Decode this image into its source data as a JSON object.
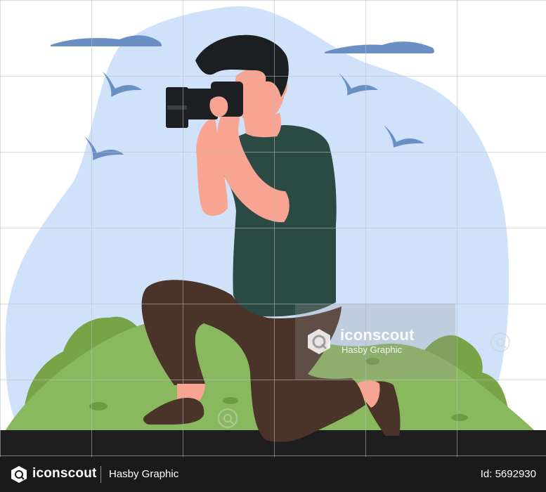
{
  "watermark": {
    "brand": "iconscout",
    "author": "Hasby Graphic"
  },
  "footer": {
    "brand": "iconscout",
    "author": "Hasby Graphic",
    "id_text": "Id: 5692930"
  },
  "colors": {
    "sky": "#cfe2fa",
    "clouds_birds": "#6a8fc4",
    "hill_dark": "#78a447",
    "hill_light": "#8ab85e",
    "ground_strip": "#1e1e1e",
    "shirt": "#2c4a44",
    "trousers": "#4a3328",
    "skin": "#f7a492",
    "hair": "#1c1f22",
    "camera": "#1d1f22",
    "shoes": "#4a3328",
    "footer_bg": "#1a1a1a"
  },
  "icons": [
    "iconscout-logo-icon",
    "search-mark-icon"
  ]
}
